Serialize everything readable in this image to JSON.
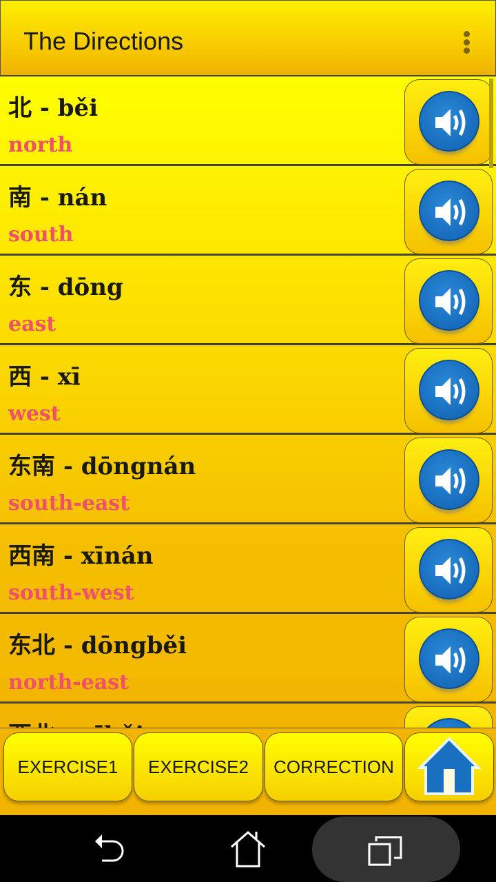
{
  "header": {
    "title": "The Directions",
    "menu_icon": "more-vert-icon"
  },
  "items": [
    {
      "chinese": "北 - běi",
      "english": "north"
    },
    {
      "chinese": "南 - nán",
      "english": "south"
    },
    {
      "chinese": "东 - dōng",
      "english": "east"
    },
    {
      "chinese": "西 - xī",
      "english": "west"
    },
    {
      "chinese": "东南 - dōngnán",
      "english": "south-east"
    },
    {
      "chinese": "西南 - xīnán",
      "english": "south-west"
    },
    {
      "chinese": "东北 - dōngběi",
      "english": "north-east"
    },
    {
      "chinese": "西北 - xīběi",
      "english": ""
    }
  ],
  "bottom": {
    "exercise1": "EXERCISE1",
    "exercise2": "EXERCISE2",
    "correction": "CORRECTION",
    "home_icon": "home-icon"
  },
  "colors": {
    "accent_text": "#f0506a",
    "speaker_blue": "#1a70c0",
    "bar_yellow": "#ffef00"
  }
}
